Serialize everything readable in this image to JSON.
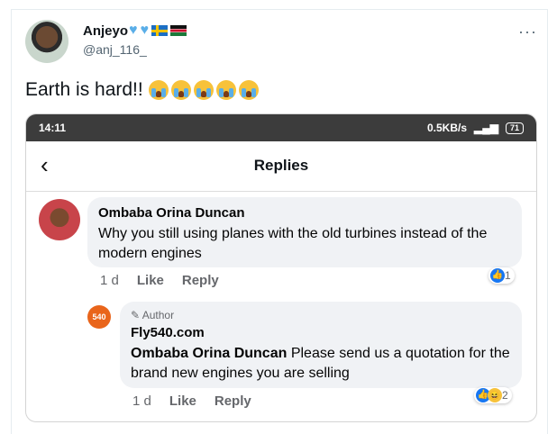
{
  "tweet": {
    "display_name": "Anjeyo",
    "badge_icons": [
      "blue-heart-icon",
      "blue-heart-icon",
      "sweden-flag-icon",
      "kenya-flag-icon"
    ],
    "handle": "@anj_116_",
    "more_label": "···",
    "text": "Earth is hard!!",
    "trailing_emoji": [
      "crying-face",
      "crying-face",
      "crying-face",
      "crying-face",
      "crying-face"
    ]
  },
  "phone": {
    "status_time": "14:11",
    "status_right": "0.5KB/s",
    "battery": "71",
    "page_title": "Replies",
    "back_label": "‹"
  },
  "comment": {
    "author": "Ombaba Orina Duncan",
    "text": "Why you still using planes with the old turbines instead of the modern engines",
    "time": "1 d",
    "like_label": "Like",
    "reply_label": "Reply",
    "reaction_count": "1"
  },
  "reply": {
    "avatar_text": "540",
    "author_badge": "Author",
    "author": "Fly540.com",
    "mention": "Ombaba Orina Duncan",
    "text": " Please send us a quotation for the brand new engines you are selling",
    "time": "1 d",
    "like_label": "Like",
    "reply_label": "Reply",
    "reaction_count": "2"
  },
  "colors": {
    "accent": "#1877f2",
    "heart": "#5aaee8",
    "fly540": "#e9651b"
  }
}
